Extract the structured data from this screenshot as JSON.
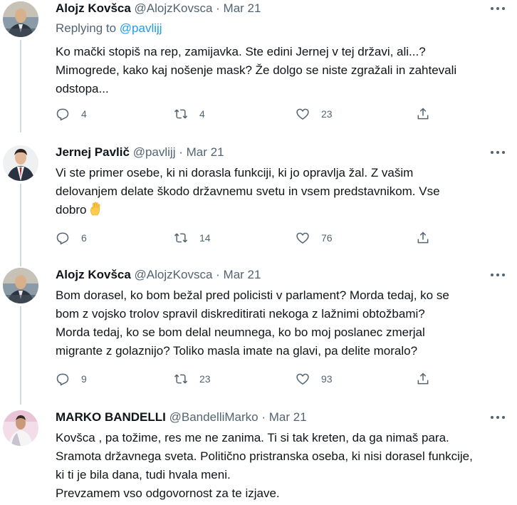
{
  "tweets": [
    {
      "name": "Alojz Kovšca",
      "handle": "@AlojzKovsca",
      "date": "Mar 21",
      "replying_label": "Replying to ",
      "replying_handle": "@pavlijj",
      "text_lines": [
        "Ko mački stopiš na rep, zamijavka. Ste edini Jernej v tej državi, ali...?",
        "Mimogrede, kako kaj nošenje mask? Že dolgo se niste zgražali in zahtevali",
        "odstopa..."
      ],
      "replies": "4",
      "retweets": "4",
      "likes": "23"
    },
    {
      "name": "Jernej Pavlič",
      "handle": "@pavlijj",
      "date": "Mar 21",
      "text_lines": [
        "Vi ste primer osebe, ki ni dorasla funkciji, ki jo opravlja žal. Z vašim",
        "delovanjem delate škodo državnemu svetu in vsem predstavnikom. Vse",
        "dobro"
      ],
      "replies": "6",
      "retweets": "14",
      "likes": "76"
    },
    {
      "name": "Alojz Kovšca",
      "handle": "@AlojzKovsca",
      "date": "Mar 21",
      "text_lines": [
        "Bom dorasel, ko bom bežal pred policisti v parlament? Morda tedaj, ko se",
        "bom z vojsko trolov spravil diskreditirati nekoga z lažnimi obtožbami?",
        "Morda tedaj, ko se bom delal neumnega, ko bo moj poslanec zmerjal",
        "migrante z golaznijo? Toliko masla imate na glavi, pa delite moralo?"
      ],
      "replies": "9",
      "retweets": "23",
      "likes": "93"
    },
    {
      "name": "MARKO BANDELLI",
      "handle": "@BandelliMarko",
      "date": "Mar 21",
      "text_lines": [
        "Kovšca , pa tožime, res me ne zanima. Ti si tak kreten, da ga nimaš para.",
        "Sramota državnega sveta. Politično pristranska oseba, ki nisi dorasel funkcije,",
        "ki ti je bila dana, tudi hvala meni.",
        "Prevzamem vso odgovornost za te izjave."
      ]
    }
  ],
  "separator": "·",
  "icons": {
    "more": "more-dots-icon",
    "reply": "reply-icon",
    "retweet": "retweet-icon",
    "like": "heart-icon",
    "share": "share-icon",
    "emoji": "raised-hand-emoji"
  },
  "colors": {
    "text": "#0f1419",
    "secondary": "#536471",
    "link": "#1d9bf0",
    "thread_line": "#cfd9de"
  }
}
